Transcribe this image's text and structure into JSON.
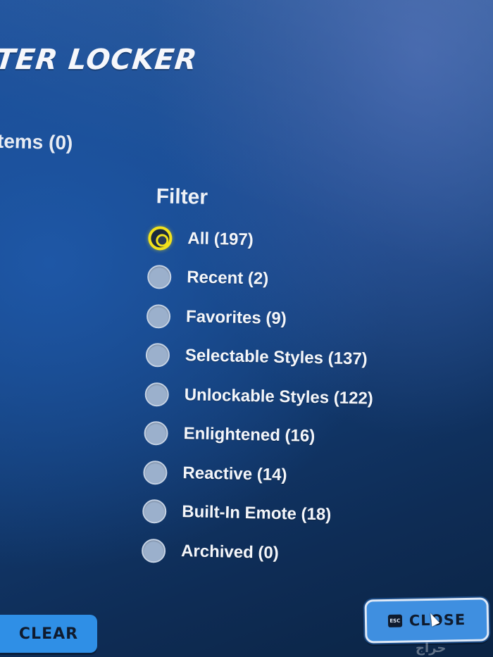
{
  "header": {
    "title": "TER LOCKER"
  },
  "items_label": "tems (0)",
  "filter": {
    "heading": "Filter",
    "options": [
      {
        "label": "All (197)",
        "selected": true
      },
      {
        "label": "Recent (2)",
        "selected": false
      },
      {
        "label": "Favorites (9)",
        "selected": false
      },
      {
        "label": "Selectable Styles (137)",
        "selected": false
      },
      {
        "label": "Unlockable Styles (122)",
        "selected": false
      },
      {
        "label": "Enlightened (16)",
        "selected": false
      },
      {
        "label": "Reactive (14)",
        "selected": false
      },
      {
        "label": "Built-In Emote (18)",
        "selected": false
      },
      {
        "label": "Archived (0)",
        "selected": false
      }
    ]
  },
  "footer": {
    "clear_label": "CLEAR",
    "close_label": "CLOSE",
    "close_key_hint": "ESC"
  },
  "watermark": "حراج",
  "colors": {
    "background": "#174688",
    "radio_selected": "#f2e21c",
    "radio_unselected": "#9bb0cc",
    "button_blue": "#2f8fe6"
  }
}
